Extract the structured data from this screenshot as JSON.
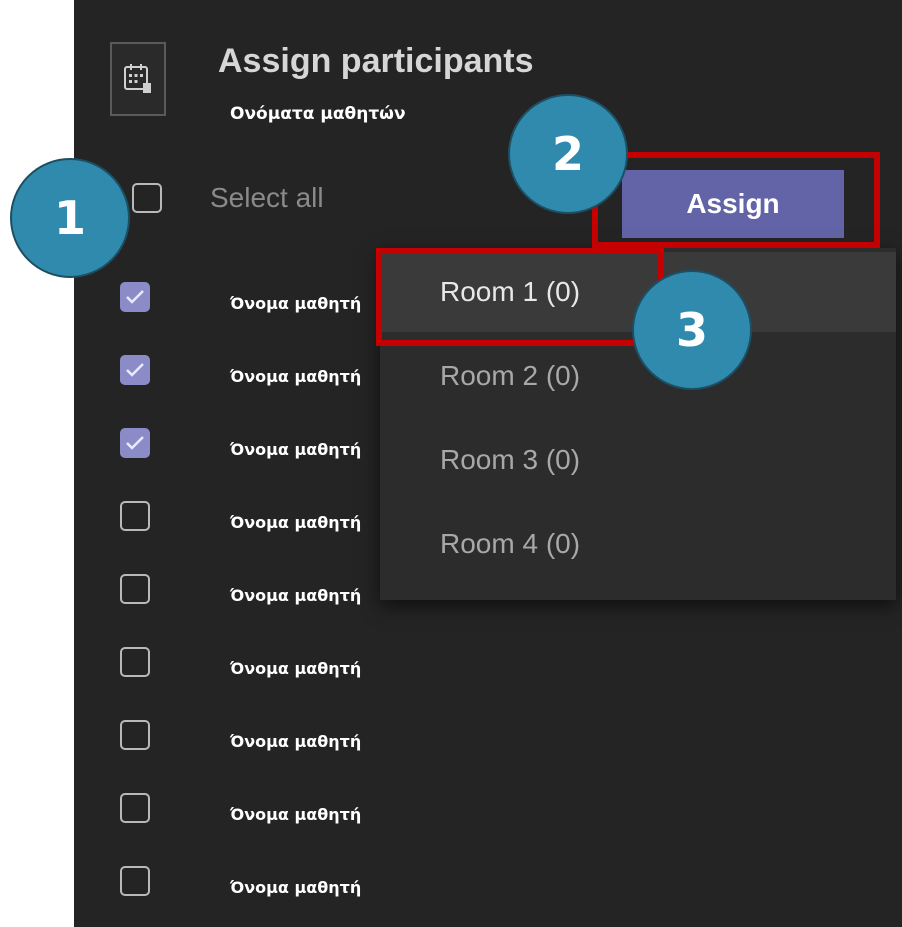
{
  "header": {
    "title": "Assign participants",
    "subtitle": "Ονόματα μαθητών",
    "icon": "calendar-grid-icon"
  },
  "select_all": {
    "label": "Select all",
    "checked": false
  },
  "assign_button": {
    "label": "Assign",
    "color": "#6264a7"
  },
  "participants": [
    {
      "name": "Όνομα μαθητή",
      "checked": true
    },
    {
      "name": "Όνομα μαθητή",
      "checked": true
    },
    {
      "name": "Όνομα μαθητή",
      "checked": true
    },
    {
      "name": "Όνομα μαθητή",
      "checked": false
    },
    {
      "name": "Όνομα μαθητή",
      "checked": false
    },
    {
      "name": "Όνομα μαθητή",
      "checked": false
    },
    {
      "name": "Όνομα μαθητή",
      "checked": false
    },
    {
      "name": "Όνομα μαθητή",
      "checked": false
    },
    {
      "name": "Όνομα μαθητή",
      "checked": false
    }
  ],
  "rooms": [
    {
      "label": "Room 1 (0)",
      "hovered": true
    },
    {
      "label": "Room 2 (0)",
      "hovered": false
    },
    {
      "label": "Room 3 (0)",
      "hovered": false
    },
    {
      "label": "Room 4 (0)",
      "hovered": false
    }
  ],
  "callouts": {
    "step1": "1",
    "step2": "2",
    "step3": "3",
    "color": "#2f8aae"
  },
  "colors": {
    "highlight": "#c40000",
    "checkbox_checked": "#8b8cc7",
    "panel_background": "#242424"
  }
}
